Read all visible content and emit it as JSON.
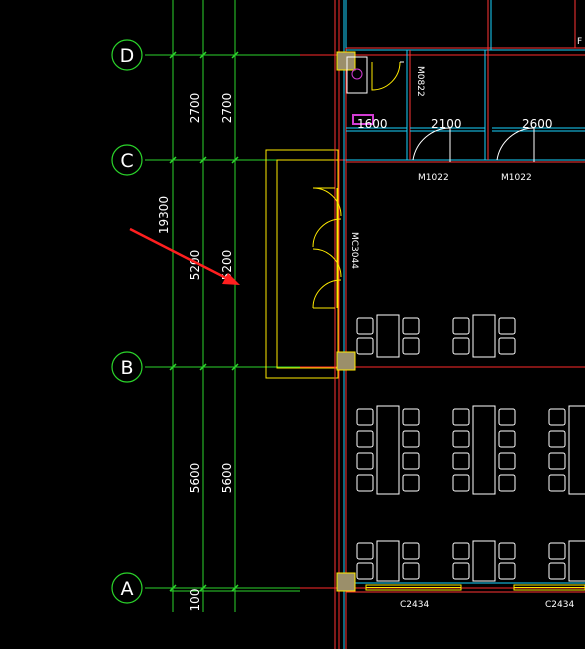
{
  "colors": {
    "background": "#000000",
    "axis_line": "#ff2a2a",
    "dimension": "#2bd52b",
    "wall": "#ff3333",
    "wall_inner": "#19d3ff",
    "window": "#ffea00",
    "furniture": "#ffffff",
    "column_fill": "#9b8f6a",
    "arrow": "#ff1f1f",
    "magenta": "#d33cd3"
  },
  "axes": {
    "D": "D",
    "C": "C",
    "B": "B",
    "A": "A"
  },
  "dimensions": {
    "total": "19300",
    "dc_outer": "2700",
    "dc_inner": "2700",
    "cb_outer": "5200",
    "cb_inner": "5200",
    "ba_outer": "5600",
    "ba_inner": "5600",
    "bottom_offset": "100",
    "room_width_1": "1600",
    "room_width_2": "2100",
    "room_width_3": "2600"
  },
  "labels": {
    "door_m0822": "M0822",
    "door_m1022_a": "M1022",
    "door_m1022_b": "M1022",
    "door_mc3044": "MC3044",
    "window_c2434_a": "C2434",
    "window_c2434_b": "C2434",
    "corner_fragment": "F"
  },
  "icons": {
    "pointer": "red-arrow-icon",
    "sink": "washbasin-icon"
  }
}
